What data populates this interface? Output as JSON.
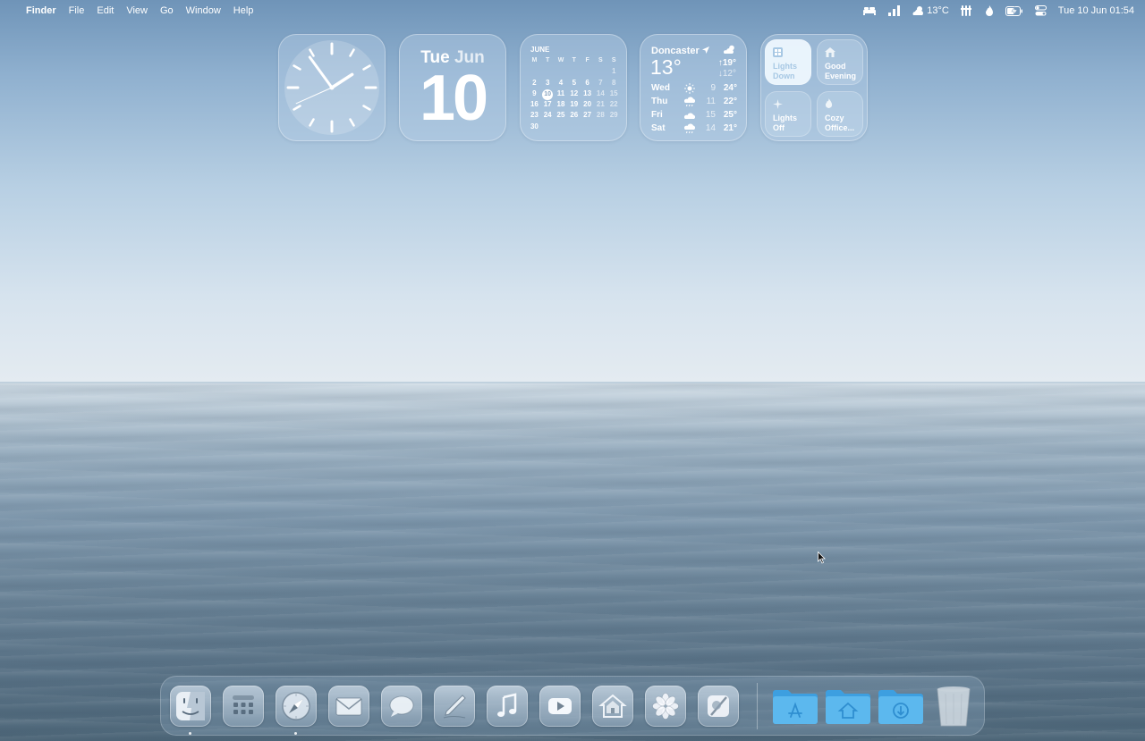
{
  "menubar": {
    "apple_glyph": "",
    "app_name": "Finder",
    "menus": [
      "File",
      "Edit",
      "View",
      "Go",
      "Window",
      "Help"
    ],
    "status": {
      "weather_text": "13°C",
      "datetime": "Tue 10 Jun  01:54"
    },
    "status_icons": [
      "bed-icon",
      "cellular-signal-icon",
      "weather-icon",
      "fork-knife-icon",
      "flame-icon",
      "battery-charging-icon",
      "control-center-icon"
    ]
  },
  "widgets": {
    "clock": {
      "time": "01:54"
    },
    "date": {
      "weekday": "Tue",
      "month": "Jun",
      "day": "10"
    },
    "calendar": {
      "month": "JUNE",
      "weekdays": [
        "M",
        "T",
        "W",
        "T",
        "F",
        "S",
        "S"
      ],
      "leading_blanks": 6,
      "days_in_month": 30,
      "today": 10
    },
    "weather": {
      "city": "Doncaster",
      "current": "13°",
      "high": "19°",
      "low": "12°",
      "forecast": [
        {
          "day": "Wed",
          "icon": "sun-icon",
          "low": "9",
          "high": "24°"
        },
        {
          "day": "Thu",
          "icon": "rain-icon",
          "low": "11",
          "high": "22°"
        },
        {
          "day": "Fri",
          "icon": "cloud-icon",
          "low": "15",
          "high": "25°"
        },
        {
          "day": "Sat",
          "icon": "rain-icon",
          "low": "14",
          "high": "21°"
        }
      ]
    },
    "home": {
      "tiles": [
        {
          "line1": "Lights",
          "line2": "Down",
          "icon": "scene-icon",
          "active": true
        },
        {
          "line1": "Good",
          "line2": "Evening",
          "icon": "house-icon",
          "active": false
        },
        {
          "line1": "Lights",
          "line2": "Off",
          "icon": "sparkle-icon",
          "active": false
        },
        {
          "line1": "Cozy",
          "line2": "Office...",
          "icon": "flame-icon",
          "active": false
        }
      ]
    }
  },
  "dock": {
    "apps": [
      "Finder",
      "Launchpad",
      "Safari",
      "Mail",
      "Messages",
      "Freeform",
      "Music",
      "YouTube",
      "Home",
      "Photos",
      "Capture"
    ],
    "folders": [
      "Applications",
      "Home",
      "Downloads"
    ],
    "trash": "Trash"
  },
  "colors": {
    "folder_blue": "#58b5ea",
    "sky_top": "#6f94b8",
    "horizon": "#e4ebf1",
    "sea_bottom": "#4e6779"
  }
}
